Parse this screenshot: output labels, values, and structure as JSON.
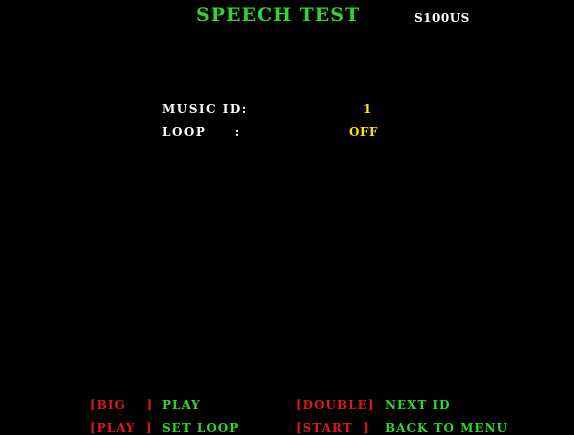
{
  "screen": {
    "title": "SPEECH TEST",
    "version": "S100US"
  },
  "settings": [
    {
      "label": "MUSIC ID:",
      "value": "1"
    },
    {
      "label": "LOOP     :",
      "value": "OFF"
    }
  ],
  "controls": [
    {
      "button": "[BIG    ]",
      "action": "PLAY"
    },
    {
      "button": "[DOUBLE]",
      "action": "NEXT ID"
    },
    {
      "button": "[PLAY  ]",
      "action": "SET LOOP"
    },
    {
      "button": "[START  ]",
      "action": "BACK TO MENU"
    }
  ],
  "colors": {
    "background": "#000000",
    "title": "#2ed62e",
    "label": "#ffffff",
    "value": "#ffe600",
    "button": "#e01818",
    "action": "#2ed62e"
  }
}
